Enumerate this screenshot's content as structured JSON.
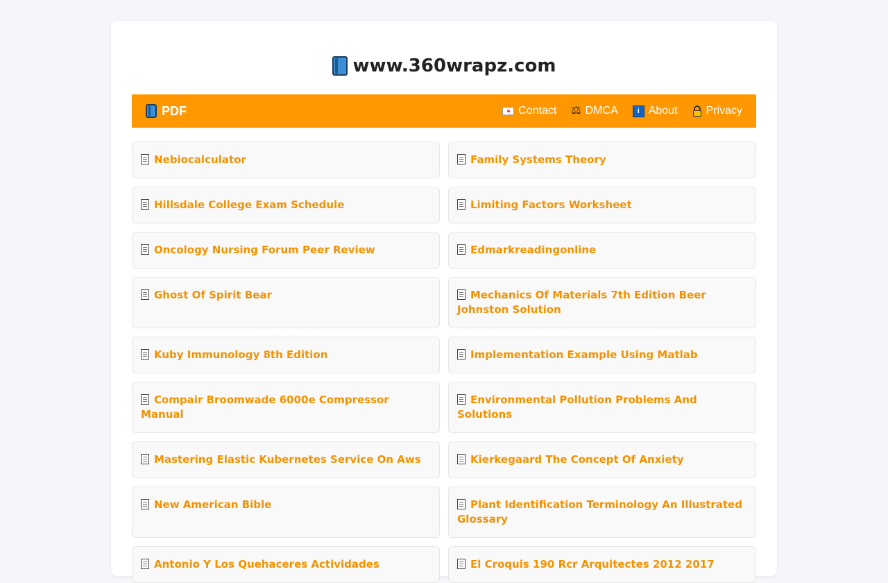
{
  "site": {
    "title": "www.360wrapz.com"
  },
  "nav": {
    "brand": "PDF",
    "links": [
      {
        "label": "Contact",
        "icon": "envelope-icon"
      },
      {
        "label": "DMCA",
        "icon": "scales-icon"
      },
      {
        "label": "About",
        "icon": "info-icon"
      },
      {
        "label": "Privacy",
        "icon": "lock-icon"
      }
    ]
  },
  "items": [
    "Nebiocalculator",
    "Family Systems Theory",
    "Hillsdale College Exam Schedule",
    "Limiting Factors Worksheet",
    "Oncology Nursing Forum Peer Review",
    "Edmarkreadingonline",
    "Ghost Of Spirit Bear",
    "Mechanics Of Materials 7th Edition Beer Johnston Solution",
    "Kuby Immunology 8th Edition",
    "Implementation Example Using Matlab",
    "Compair Broomwade 6000e Compressor Manual",
    "Environmental Pollution Problems And Solutions",
    "Mastering Elastic Kubernetes Service On Aws",
    "Kierkegaard The Concept Of Anxiety",
    "New American Bible",
    "Plant Identification Terminology An Illustrated Glossary",
    "Antonio Y Los Quehaceres Actividades",
    "El Croquis 190 Rcr Arquitectes 2012 2017"
  ],
  "colors": {
    "accent": "#ff9800",
    "link": "#f39200"
  }
}
